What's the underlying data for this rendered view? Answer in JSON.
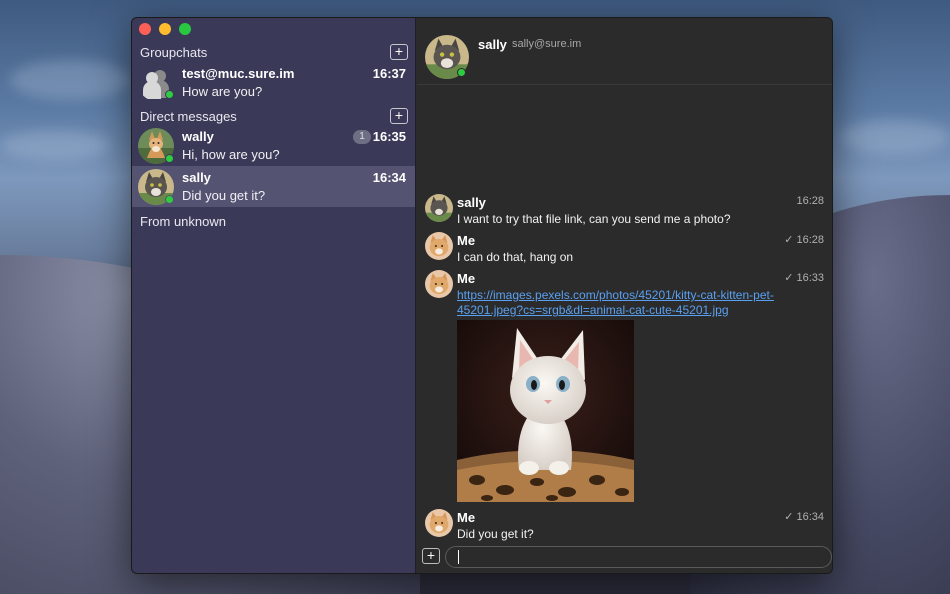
{
  "window": {
    "traffic_lights": [
      "close",
      "minimize",
      "zoom"
    ]
  },
  "sidebar": {
    "groupchats_label": "Groupchats",
    "direct_messages_label": "Direct messages",
    "from_unknown_label": "From unknown",
    "add_label": "+",
    "groupchats": [
      {
        "name": "test@muc.sure.im",
        "last_message": "How are you?",
        "time": "16:37",
        "online": true,
        "icon": "group-avatar-icon"
      }
    ],
    "direct_messages": [
      {
        "name": "wally",
        "last_message": "Hi, how are you?",
        "time": "16:35",
        "unread": "1",
        "online": true,
        "selected": false
      },
      {
        "name": "sally",
        "last_message": "Did you get it?",
        "time": "16:34",
        "online": true,
        "selected": true
      }
    ]
  },
  "chat": {
    "header": {
      "name": "sally",
      "jid": "sally@sure.im",
      "online": true
    },
    "messages": [
      {
        "sender": "sally",
        "time": "16:28",
        "text": "I want to try that file link, can you send me a photo?",
        "delivered": false
      },
      {
        "sender": "Me",
        "time": "✓ 16:28",
        "text": "I can do that, hang on",
        "delivered": true
      },
      {
        "sender": "Me",
        "time": "✓ 16:33",
        "link": "https://images.pexels.com/photos/45201/kitty-cat-kitten-pet-45201.jpeg?cs=srgb&dl=animal-cat-cute-45201.jpg",
        "image": "white-kitten-photo",
        "delivered": true
      },
      {
        "sender": "Me",
        "time": "✓ 16:34",
        "text": "Did you get it?",
        "delivered": true
      }
    ],
    "composer": {
      "attach_label": "+",
      "value": ""
    }
  },
  "colors": {
    "sidebar_bg": "#3a3a58",
    "selected_row_bg": "#545472",
    "chat_bg": "#2b2b2b",
    "online_dot": "#2ecc40",
    "link": "#5aa0f0"
  }
}
